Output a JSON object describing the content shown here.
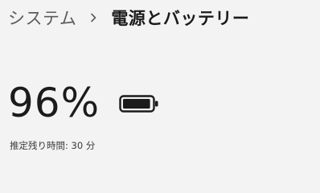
{
  "breadcrumb": {
    "parent": "システム",
    "separator_icon": "chevron-right-icon",
    "current": "電源とバッテリー"
  },
  "battery": {
    "percent_text": "96%",
    "level": 0.96,
    "icon": "battery-full-icon",
    "remaining_label": "推定残り時間:",
    "remaining_value": "30 分"
  }
}
